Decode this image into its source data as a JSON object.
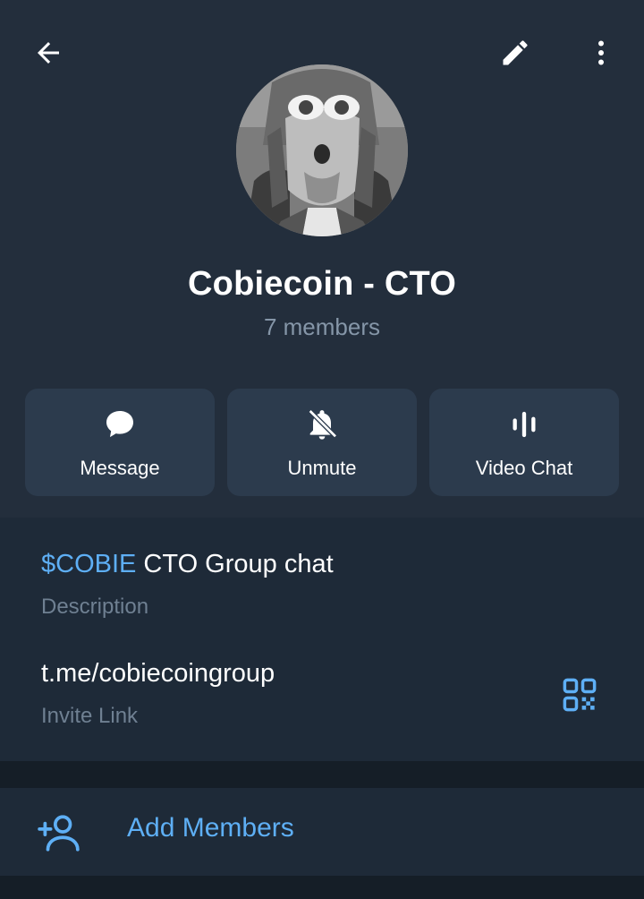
{
  "header": {
    "group_name": "Cobiecoin - CTO",
    "members": "7 members",
    "icons": {
      "back": "arrow-left-icon",
      "edit": "pencil-icon",
      "more": "more-vertical-icon"
    }
  },
  "actions": [
    {
      "label": "Message",
      "icon": "chat-bubble-icon"
    },
    {
      "label": "Unmute",
      "icon": "bell-off-icon"
    },
    {
      "label": "Video Chat",
      "icon": "audio-waves-icon"
    }
  ],
  "info": {
    "description_tag": "$COBIE",
    "description_rest": " CTO Group chat",
    "description_label": "Description",
    "invite_link": "t.me/cobiecoingroup",
    "invite_label": "Invite Link",
    "qr_icon": "qr-code-icon"
  },
  "add_members": {
    "label": "Add Members",
    "icon": "add-user-icon"
  },
  "colors": {
    "header_bg": "#232e3c",
    "section_bg": "#1e2a38",
    "action_bg": "#2c3b4d",
    "accent": "#5eaff5",
    "muted": "#8596a8"
  }
}
